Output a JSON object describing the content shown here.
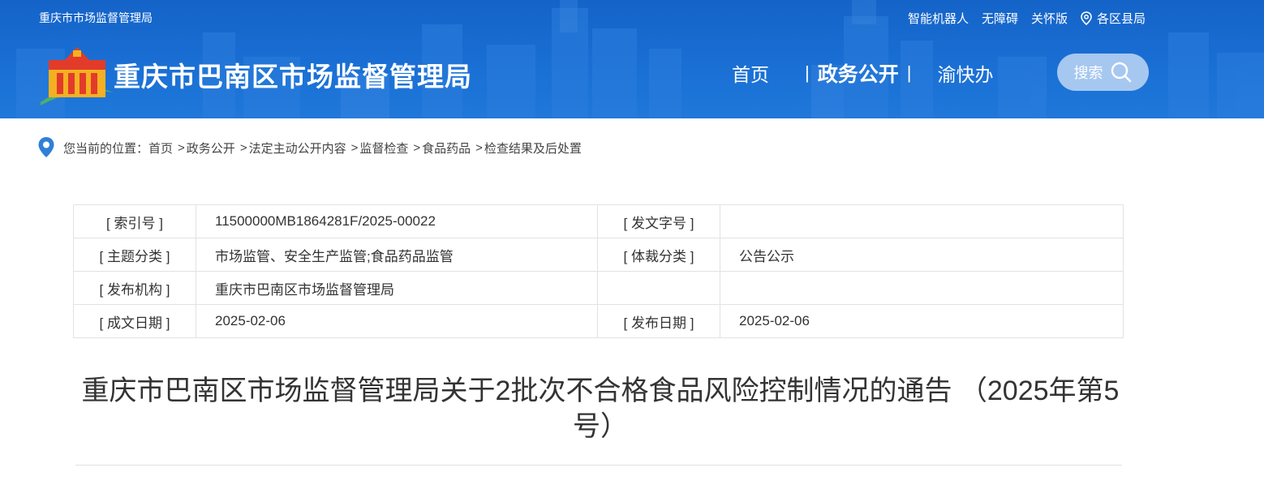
{
  "header": {
    "site_short": "重庆市市场监督管理局",
    "title": "重庆市巴南区市场监督管理局",
    "top_links": [
      {
        "label": "智能机器人"
      },
      {
        "label": "无障碍"
      },
      {
        "label": "关怀版"
      },
      {
        "label": "各区县局",
        "icon": "location-pin-icon"
      }
    ],
    "nav": [
      {
        "label": "首页"
      },
      {
        "label": "政务公开",
        "active": true
      },
      {
        "label": "渝快办"
      }
    ],
    "nav_separator": "|",
    "search_label": "搜索",
    "colors": {
      "primary": "#1a6fd4",
      "logo_red": "#e23b2a",
      "logo_yellow": "#f5b022",
      "logo_green": "#3aa35a"
    }
  },
  "breadcrumb": {
    "prefix": "您当前的位置：",
    "items": [
      "首页",
      "政务公开",
      "法定主动公开内容",
      "监督检查",
      "食品药品",
      "检查结果及后处置"
    ],
    "separator": ">"
  },
  "meta": {
    "rows": [
      {
        "k1": "[ 索引号 ]",
        "v1": "11500000MB1864281F/2025-00022",
        "k2": "[ 发文字号 ]",
        "v2": ""
      },
      {
        "k1": "[ 主题分类 ]",
        "v1": "市场监管、安全生产监管;食品药品监管",
        "k2": "[ 体裁分类 ]",
        "v2": "公告公示"
      },
      {
        "k1": "[ 发布机构 ]",
        "v1": "重庆市巴南区市场监督管理局",
        "k2": "",
        "v2": ""
      },
      {
        "k1": "[ 成文日期 ]",
        "v1": "2025-02-06",
        "k2": "[ 发布日期 ]",
        "v2": "2025-02-06"
      }
    ]
  },
  "document": {
    "title": "重庆市巴南区市场监督管理局关于2批次不合格食品风险控制情况的通告 （2025年第5号）"
  }
}
